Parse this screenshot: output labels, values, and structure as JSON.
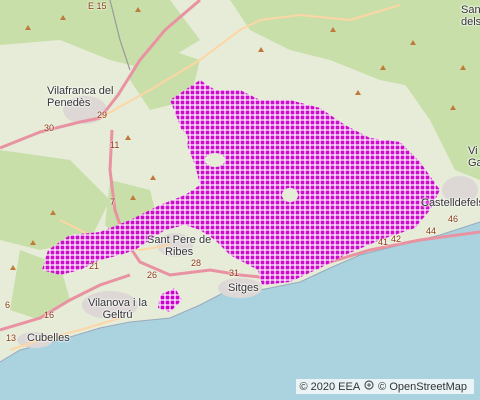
{
  "map": {
    "colors": {
      "sea": "#aad3df",
      "land": "#e6ecd8",
      "forest": "#c8dfa9",
      "highway": "#e892a2",
      "primary": "#fcd6a4",
      "overlay": "#cc00cc"
    },
    "places": [
      {
        "id": "vilafranca",
        "text": "Vilafranca del\nPenedès"
      },
      {
        "id": "sant-pere",
        "text": "Sant Pere de\nRibes"
      },
      {
        "id": "sitges",
        "text": "Sitges"
      },
      {
        "id": "vilanova",
        "text": "Vilanova i la\nGeltrú"
      },
      {
        "id": "cubelles",
        "text": "Cubelles"
      },
      {
        "id": "castelldefels",
        "text": "Castelldefels"
      },
      {
        "id": "sant-dels",
        "text": "Sant\ndels"
      },
      {
        "id": "gava",
        "text": "Vi\nGa"
      }
    ],
    "road_numbers": [
      "E 15",
      "29",
      "30",
      "11",
      "7",
      "21",
      "26",
      "28",
      "31",
      "16",
      "13",
      "42",
      "41",
      "44",
      "46",
      "6"
    ],
    "attribution": {
      "eea": "© 2020 EEA",
      "osm_icon": "openstreetmap-icon",
      "osm": "© OpenStreetMap"
    }
  }
}
